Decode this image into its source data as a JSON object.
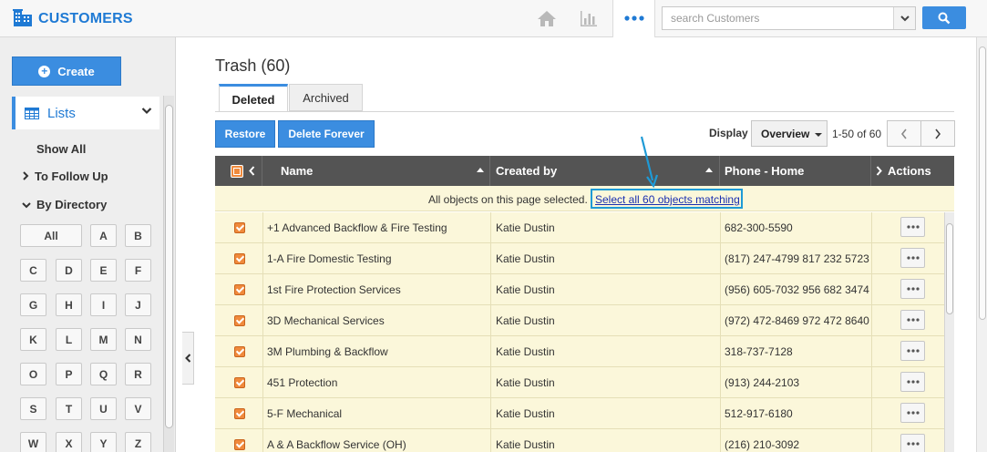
{
  "app": {
    "title": "CUSTOMERS"
  },
  "search": {
    "placeholder": "search Customers"
  },
  "sidebar": {
    "create_label": "Create",
    "lists_label": "Lists",
    "show_all": "Show All",
    "to_follow_up": "To Follow Up",
    "by_directory": "By Directory",
    "directory": [
      "All",
      "A",
      "B",
      "C",
      "D",
      "E",
      "F",
      "G",
      "H",
      "I",
      "J",
      "K",
      "L",
      "M",
      "N",
      "O",
      "P",
      "Q",
      "R",
      "S",
      "T",
      "U",
      "V",
      "W",
      "X",
      "Y",
      "Z"
    ]
  },
  "main": {
    "title": "Trash (60)",
    "tabs": [
      {
        "label": "Deleted"
      },
      {
        "label": "Archived"
      }
    ],
    "restore_label": "Restore",
    "delete_forever_label": "Delete Forever",
    "display_label": "Display",
    "display_value": "Overview",
    "page_range": "1-50 of 60",
    "columns": {
      "name": "Name",
      "created_by": "Created by",
      "phone": "Phone - Home",
      "actions": "Actions"
    },
    "selection_notice": "All objects on this page selected.",
    "select_all_link": "Select all 60 objects matching",
    "rows": [
      {
        "name": "+1 Advanced Backflow & Fire Testing",
        "created_by": "Katie Dustin",
        "phone": "682-300-5590"
      },
      {
        "name": "1-A Fire Domestic Testing",
        "created_by": "Katie Dustin",
        "phone": "(817) 247-4799 817 232 5723"
      },
      {
        "name": "1st Fire Protection Services",
        "created_by": "Katie Dustin",
        "phone": "(956) 605-7032 956 682 3474"
      },
      {
        "name": "3D Mechanical Services",
        "created_by": "Katie Dustin",
        "phone": "(972) 472-8469 972 472 8640"
      },
      {
        "name": "3M Plumbing & Backflow",
        "created_by": "Katie Dustin",
        "phone": "318-737-7128"
      },
      {
        "name": "451 Protection",
        "created_by": "Katie Dustin",
        "phone": "(913) 244-2103"
      },
      {
        "name": "5-F Mechanical",
        "created_by": "Katie Dustin",
        "phone": "512-917-6180"
      },
      {
        "name": "A & A Backflow Service (OH)",
        "created_by": "Katie Dustin",
        "phone": "(216) 210-3092"
      }
    ]
  },
  "colors": {
    "accent": "#3b8de0",
    "brand": "#1f7ad4",
    "header": "#545454",
    "row_bg": "#fbf7da",
    "checkbox": "#f08a3c",
    "highlight": "#1e9ad6"
  }
}
